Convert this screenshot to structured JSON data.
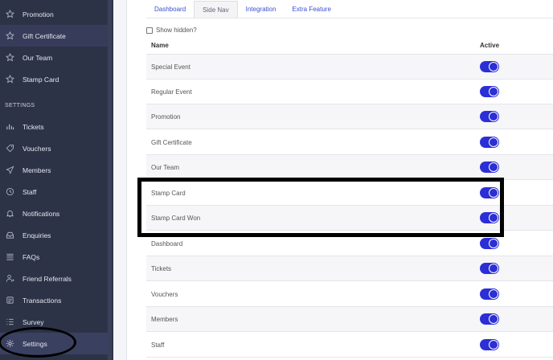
{
  "sidebar": {
    "items_top": [
      {
        "label": "Promotion",
        "icon": "star-icon"
      },
      {
        "label": "Gift Certificate",
        "icon": "star-icon"
      },
      {
        "label": "Our Team",
        "icon": "star-icon"
      },
      {
        "label": "Stamp Card",
        "icon": "star-icon"
      }
    ],
    "settings_heading": "SETTINGS",
    "items_settings": [
      {
        "label": "Tickets",
        "icon": "bar-chart-icon"
      },
      {
        "label": "Vouchers",
        "icon": "tag-icon"
      },
      {
        "label": "Members",
        "icon": "send-icon"
      },
      {
        "label": "Staff",
        "icon": "clock-icon"
      },
      {
        "label": "Notifications",
        "icon": "bell-icon"
      },
      {
        "label": "Enquiries",
        "icon": "inbox-icon"
      },
      {
        "label": "FAQs",
        "icon": "list-icon"
      },
      {
        "label": "Friend Referrals",
        "icon": "user-icon"
      },
      {
        "label": "Transactions",
        "icon": "receipt-icon"
      },
      {
        "label": "Survey",
        "icon": "list-check-icon"
      },
      {
        "label": "Settings",
        "icon": "gear-icon"
      }
    ]
  },
  "tabs": [
    {
      "label": "Dashboard",
      "active": false
    },
    {
      "label": "Side Nav",
      "active": true
    },
    {
      "label": "Integration",
      "active": false
    },
    {
      "label": "Extra Feature",
      "active": false
    }
  ],
  "filter": {
    "show_hidden_label": "Show hidden?",
    "show_hidden_checked": false
  },
  "table": {
    "headers": {
      "name": "Name",
      "active": "Active"
    },
    "rows": [
      {
        "name": "Special Event",
        "active": true
      },
      {
        "name": "Regular Event",
        "active": true
      },
      {
        "name": "Promotion",
        "active": true
      },
      {
        "name": "Gift Certificate",
        "active": true
      },
      {
        "name": "Our Team",
        "active": true
      },
      {
        "name": "Stamp Card",
        "active": true
      },
      {
        "name": "Stamp Card Won",
        "active": true
      },
      {
        "name": "Dashboard",
        "active": true
      },
      {
        "name": "Tickets",
        "active": true
      },
      {
        "name": "Vouchers",
        "active": true
      },
      {
        "name": "Members",
        "active": true
      },
      {
        "name": "Staff",
        "active": true
      }
    ]
  },
  "colors": {
    "sidebar_bg": "#2d3347",
    "accent": "#2c2fd6",
    "link": "#3b4fd0"
  }
}
